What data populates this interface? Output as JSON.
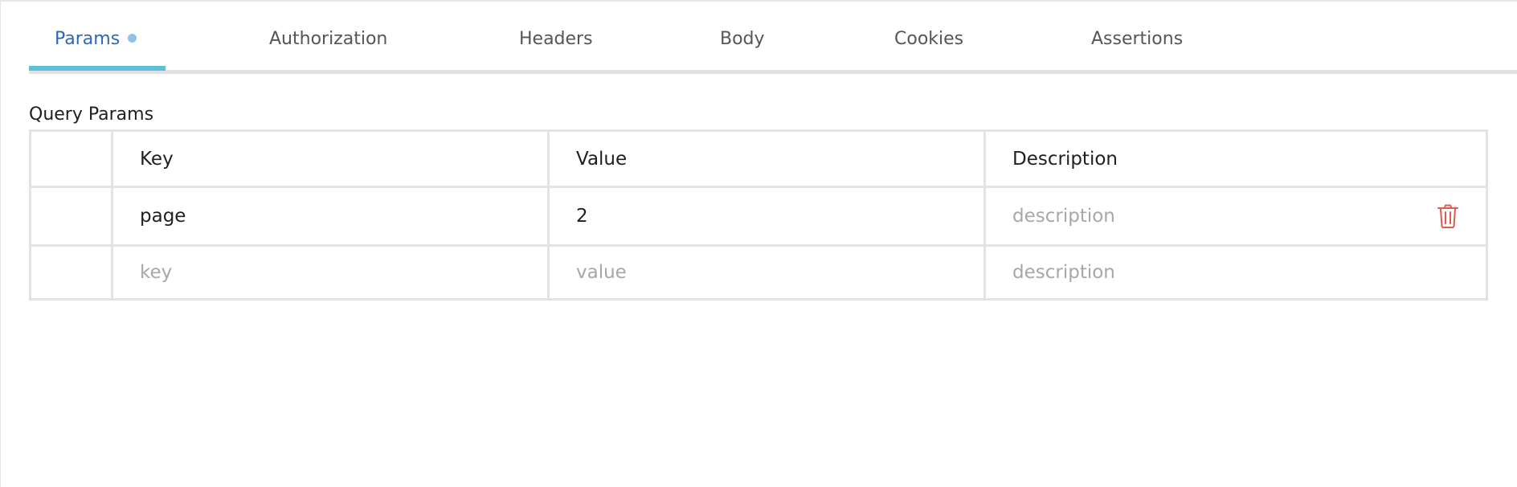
{
  "tabs": [
    {
      "label": "Params",
      "active": true,
      "indicator": true
    },
    {
      "label": "Authorization"
    },
    {
      "label": "Headers"
    },
    {
      "label": "Body"
    },
    {
      "label": "Cookies"
    },
    {
      "label": "Assertions"
    }
  ],
  "section": {
    "title": "Query Params"
  },
  "table": {
    "headers": {
      "key": "Key",
      "value": "Value",
      "description": "Description"
    },
    "rows": [
      {
        "key": "page",
        "value": "2",
        "description_placeholder": "description"
      }
    ],
    "new_row": {
      "key_placeholder": "key",
      "value_placeholder": "value",
      "description_placeholder": "description"
    }
  },
  "icons": {
    "delete": "trash-icon"
  },
  "colors": {
    "active_tab_text": "#3066b8",
    "active_tab_underline": "#5cbfd6",
    "delete_icon": "#e05a4e",
    "border": "#e3e3e3",
    "placeholder": "#a7a7a7"
  }
}
